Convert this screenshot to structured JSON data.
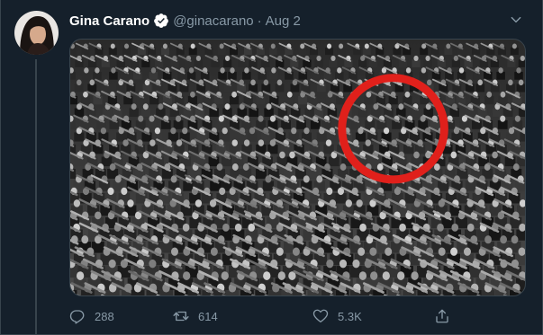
{
  "tweet": {
    "display_name": "Gina Carano",
    "handle": "@ginacarano",
    "separator": "·",
    "date": "Aug 2",
    "verified": true
  },
  "media": {
    "description_icon": "photo",
    "highlight_color": "#e0201b"
  },
  "actions": {
    "replies": "288",
    "retweets": "614",
    "likes": "5.3K"
  },
  "colors": {
    "background": "#15202b",
    "text_primary": "#ffffff",
    "text_secondary": "#8899a6",
    "verified": "#1da1f2",
    "border": "#38444d"
  }
}
